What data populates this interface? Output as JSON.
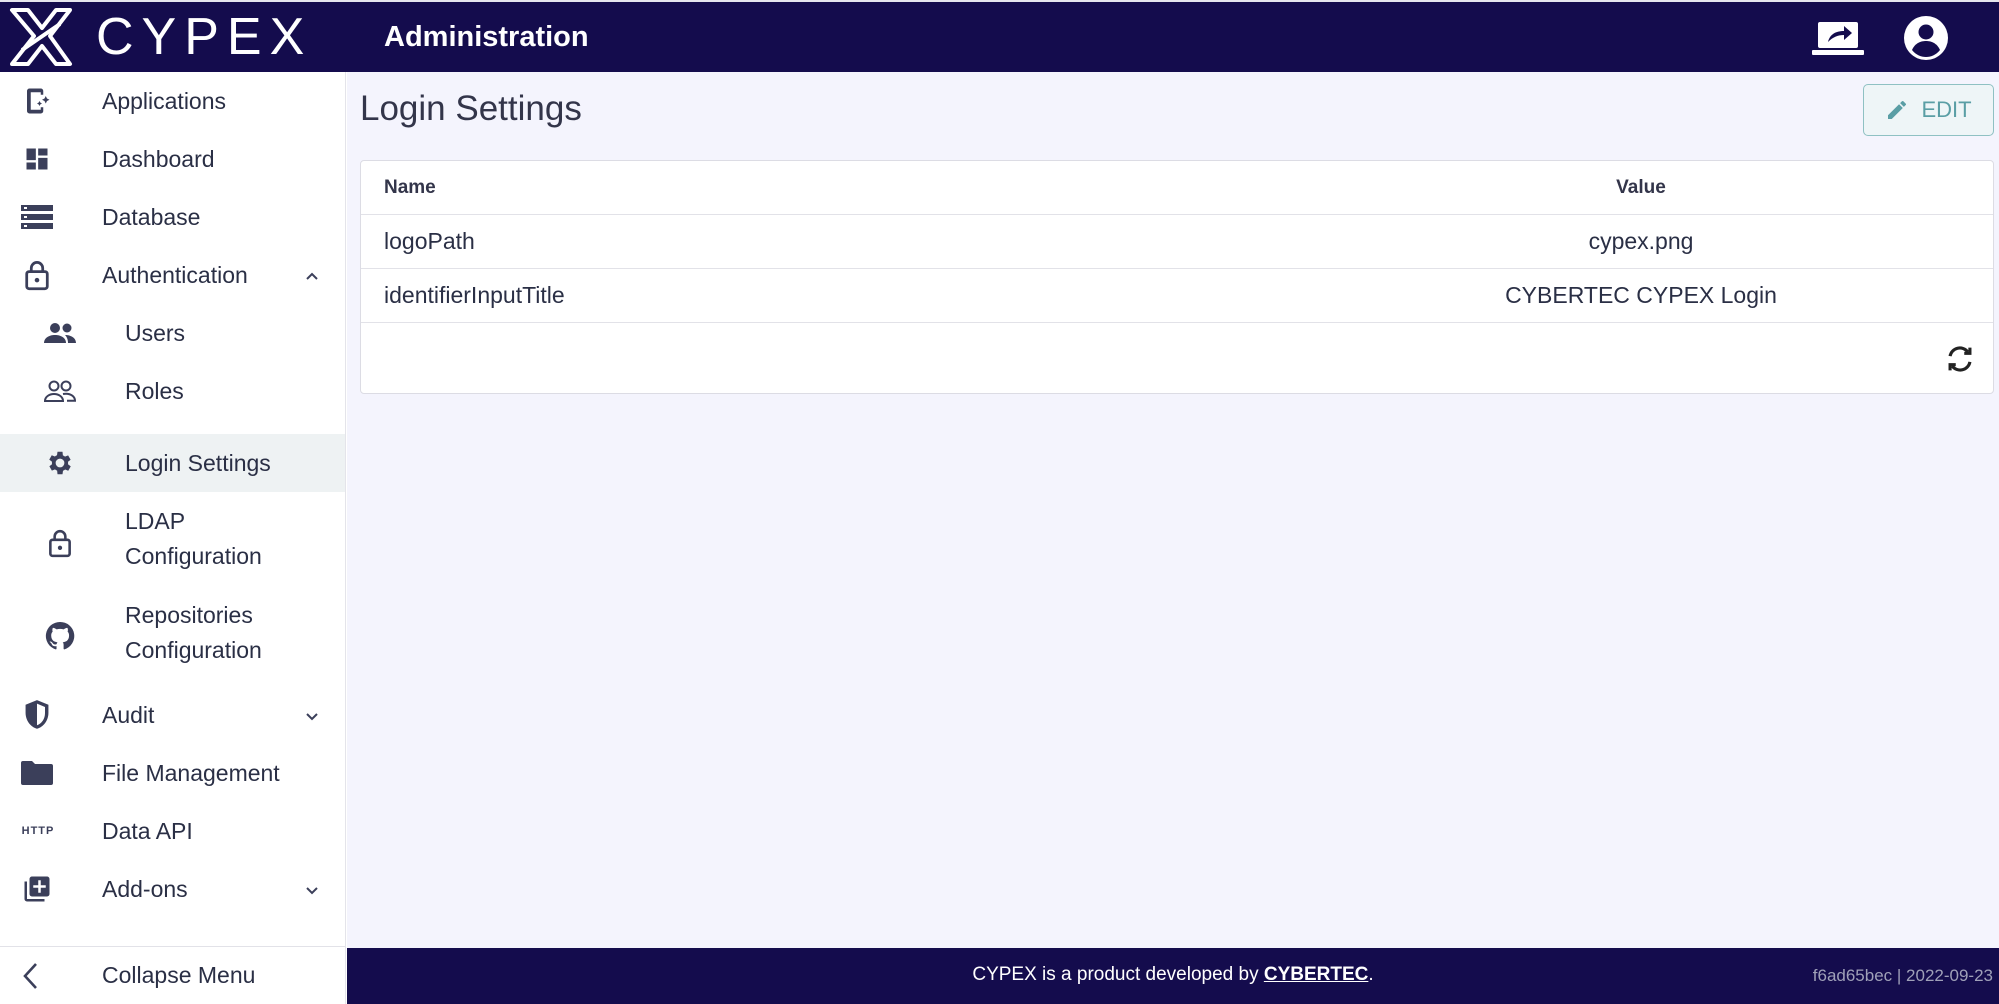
{
  "brand": {
    "name": "CYPEX",
    "logo_icon": "cypex-x-logo-icon"
  },
  "header": {
    "title": "Administration",
    "icons": [
      "share-screen-icon",
      "account-circle-icon"
    ]
  },
  "sidebar": {
    "items": [
      {
        "label": "Applications",
        "icon": "app-add-icon"
      },
      {
        "label": "Dashboard",
        "icon": "dashboard-icon"
      },
      {
        "label": "Database",
        "icon": "database-list-icon"
      },
      {
        "label": "Authentication",
        "icon": "lock-icon",
        "expanded": true
      },
      {
        "label": "Users",
        "icon": "people-icon"
      },
      {
        "label": "Roles",
        "icon": "people-outline-icon"
      },
      {
        "label": "Login Settings",
        "icon": "gear-icon",
        "active": true
      },
      {
        "label_line1": "LDAP",
        "label_line2": "Configuration",
        "icon": "lock-icon"
      },
      {
        "label_line1": "Repositories",
        "label_line2": "Configuration",
        "icon": "github-icon"
      },
      {
        "label": "Audit",
        "icon": "shield-icon",
        "expanded": false
      },
      {
        "label": "File Management",
        "icon": "folder-icon"
      },
      {
        "label": "Data API",
        "icon": "http-icon",
        "icon_text": "HTTP"
      },
      {
        "label": "Add-ons",
        "icon": "library-add-icon",
        "expanded": false
      }
    ],
    "collapse_label": "Collapse Menu"
  },
  "main": {
    "title": "Login Settings",
    "edit_label": "EDIT",
    "table": {
      "columns": [
        "Name",
        "Value"
      ],
      "rows": [
        {
          "name": "logoPath",
          "value": "cypex.png"
        },
        {
          "name": "identifierInputTitle",
          "value": "CYBERTEC CYPEX Login"
        }
      ]
    }
  },
  "footer": {
    "text": "CYPEX is a product developed by ",
    "link": "CYBERTEC",
    "suffix": ".",
    "version": "f6ad65bec | 2022-09-23"
  },
  "colors": {
    "navy": "#140c4d",
    "accent_teal": "#5a9ea5",
    "page_bg": "#f4f4fd"
  }
}
